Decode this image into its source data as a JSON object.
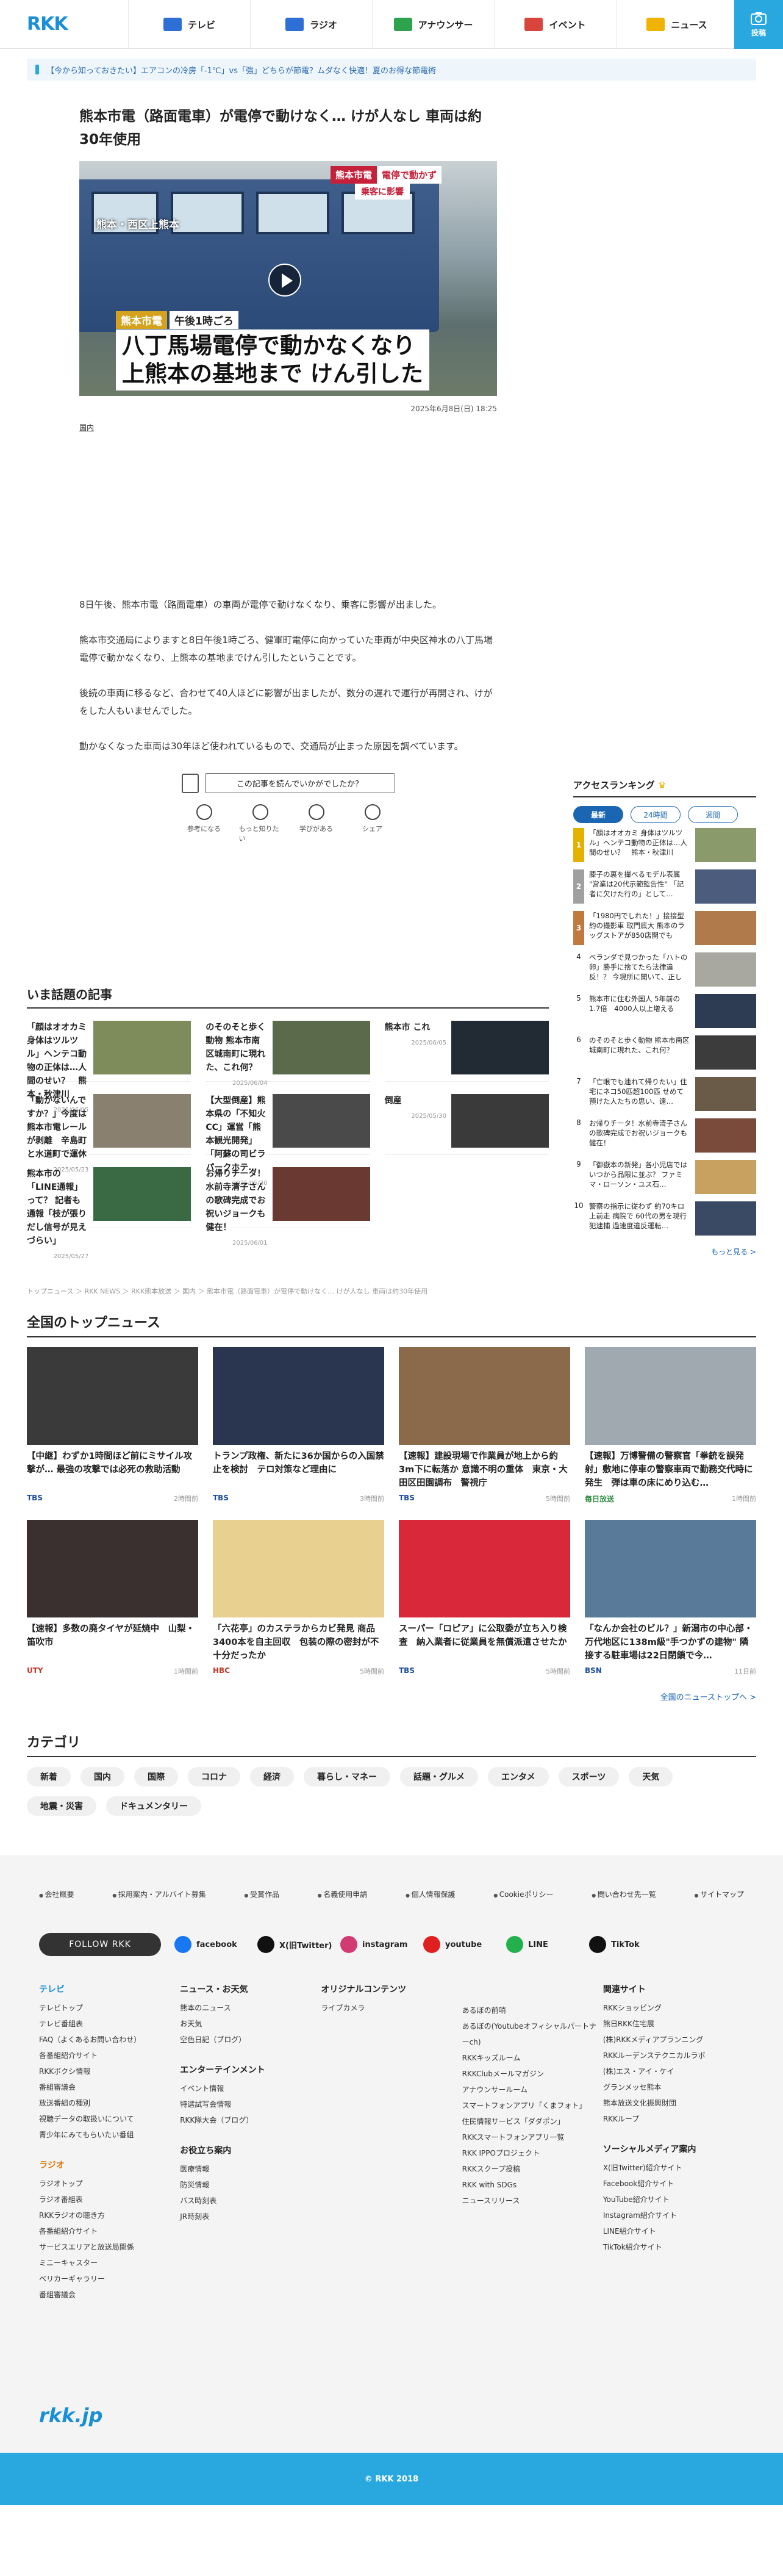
{
  "header": {
    "logo": "RKK",
    "nav": [
      {
        "label": "テレビ",
        "icon": "tv-icon",
        "color": "#2d6fd4"
      },
      {
        "label": "ラジオ",
        "icon": "radio-icon",
        "color": "#2d6fd4"
      },
      {
        "label": "アナウンサー",
        "icon": "microphone-icon",
        "color": "#2ea34d"
      },
      {
        "label": "イベント",
        "icon": "event-flag-icon",
        "color": "#d9453b"
      },
      {
        "label": "ニュース",
        "icon": "lightbulb-icon",
        "color": "#f0b400"
      }
    ],
    "submit_label": "投稿"
  },
  "notice": "【今から知っておきたい】エアコンの冷房「-1℃」vs「強」どちらが節電？ムダなく快適！夏のお得な節電術",
  "article": {
    "title": "熊本市電（路面電車）が電停で動けなく… けが人なし 車両は約30年使用",
    "hero": {
      "tag_station": "熊本市電",
      "tag_status": "電停で動かず",
      "tag_sub": "乗客に影響",
      "location": "熊本・西区上熊本",
      "time_station": "熊本市電",
      "time_text": "午後1時ごろ",
      "caption_line1": "八丁馬場電停で動かなくなり",
      "caption_line2": "上熊本の基地まで けん引した"
    },
    "date": "2025年6月8日(日) 18:25",
    "category": "国内",
    "paragraphs": [
      "8日午後、熊本市電（路面電車）の車両が電停で動けなくなり、乗客に影響が出ました。",
      "熊本市交通局によりますと8日午後1時ごろ、健軍町電停に向かっていた車両が中央区神水の八丁馬場電停で動かなくなり、上熊本の基地までけん引したということです。",
      "後続の車両に移るなど、合わせて40人ほどに影響が出ましたが、数分の遅れで運行が再開され、けがをした人もいませんでした。",
      "動かなくなった車両は30年ほど使われているもので、交通局が止まった原因を調べています。"
    ],
    "survey_question": "この記事を読んでいかがでしたか？",
    "reactions": [
      "参考になる",
      "もっと知りたい",
      "学びがある",
      "シェア"
    ]
  },
  "ranking": {
    "title": "アクセスランキング",
    "tabs": [
      "最新",
      "24時間",
      "週間"
    ],
    "items": [
      {
        "rank": "1",
        "text": "「顔はオオカミ 身体はツルツル」ヘンテコ動物の正体は…人間のせい？　熊本・秋津川",
        "img": "#8a9a6a"
      },
      {
        "rank": "2",
        "text": "膝子の裏を撮べるモデル表属 \"営業は20代示範監告性\" 「記者に欠けた行の」として…",
        "img": "#4b5c7c"
      },
      {
        "rank": "3",
        "text": "「1980円でしれた！」接接型約の撮影車 取門底大 熊本のラッグストアが850店開でも",
        "img": "#b07a4a"
      },
      {
        "rank": "4",
        "text": "ベランダで見つかった「ハトの卵」勝手に捨てたら法律違反！？ 今現所に聞いて、正しい…",
        "img": "#a8a8a0"
      },
      {
        "rank": "5",
        "text": "熊本市に住む外国人 5年前の1.7倍　4000人以上増える",
        "img": "#2d3c52"
      },
      {
        "rank": "6",
        "text": "のそのそと歩く動物 熊本市南区城南町に現れた、これ何？",
        "img": "#3c3c3c"
      },
      {
        "rank": "7",
        "text": "「亡眼でも連れて帰りたい」住宅にネコ50匹超100匹 せめて預けた人たちの思い、遠…",
        "img": "#6a5a48"
      },
      {
        "rank": "8",
        "text": "お帰りチータ！水前寺清子さんの歌碑完成でお祝いジョークも健在！",
        "img": "#7a4a3a"
      },
      {
        "rank": "9",
        "text": "「御嶽本の新発」各小児店ではいつから品限に並ぶ？ ファミマ・ローソン・ユス石…",
        "img": "#c8a060"
      },
      {
        "rank": "10",
        "text": "警察の指示に従わず 約70キロ上前走 病院で 60代の男を現行犯逮捕 過速度違反運転…",
        "img": "#3a4a64"
      }
    ],
    "more": "もっと見る >"
  },
  "hot": {
    "title": "いま話題の記事",
    "items": [
      {
        "text": "「顔はオオカミ 身体はツルツル」ヘンテコ動物の正体は…人間のせい？　熊本・秋津川",
        "date": "2025/06/05",
        "img": "#7d8c5a"
      },
      {
        "text": "のそのそと歩く動物 熊本市南区城南町に現れた、これ何？",
        "date": "2025/06/04",
        "img": "#5a6a4a"
      },
      {
        "text": "熊本市 これ",
        "date": "2025/06/05",
        "img": "#222a33"
      },
      {
        "text": "「動かないんですか？」今度は 熊本市電レールが剥離　辛島町と水道町で運休",
        "date": "2025/05/23",
        "img": "#8a8070"
      },
      {
        "text": "【大型倒産】熊本県の「不知火CC」運営「熊本観光開発」「阿蘇の司ビラパークホテ…",
        "date": "2025/05/30",
        "img": "#4a4a4a"
      },
      {
        "text": "倒産",
        "date": "2025/05/30",
        "img": "#3a3a3a"
      },
      {
        "text": "熊本市の「LINE通報」って？ 記者も通報「枝が張りだし信号が見えづらい」",
        "date": "2025/05/27",
        "img": "#3a6a44"
      },
      {
        "text": "お帰りチータ！水前寺清子さんの歌碑完成でお祝いジョークも健在！",
        "date": "2025/06/01",
        "img": "#6a3a32"
      },
      {
        "text": "",
        "date": "",
        "img": "#ffffff"
      }
    ]
  },
  "breadcrumb": "トップニュース ＞ RKK NEWS ＞ RKK熊本放送 ＞ 国内 ＞ 熊本市電（路面電車）が電停で動けなく… けが人なし 車両は約30年使用",
  "top_news": {
    "title": "全国のトップニュース",
    "items": [
      {
        "text": "【中継】わずか1時間ほど前にミサイル攻撃が… 最強の攻撃では必死の救助活動",
        "source": "TBS",
        "time": "2時間前",
        "img": "#3a3a3a",
        "src_color": "#1b4ea0"
      },
      {
        "text": "トランプ政権、新たに36か国からの入国禁止を検討　テロ対策など理由に",
        "source": "TBS",
        "time": "3時間前",
        "img": "#2a3550",
        "src_color": "#1b4ea0"
      },
      {
        "text": "【速報】建設現場で作業員が地上から約3m下に転落か 意識不明の重体　東京・大田区田園調布　警視庁",
        "source": "TBS",
        "time": "5時間前",
        "img": "#8a6a4a",
        "src_color": "#1b4ea0"
      },
      {
        "text": "【速報】万博警備の警察官「拳銃を誤発射」敷地に停車の警察車両で勤務交代時に発生　弾は車の床にめり込む…",
        "source": "毎日放送",
        "time": "1時間前",
        "img": "#a0a8b0",
        "src_color": "#2a8a3a"
      },
      {
        "text": "【速報】多数の廃タイヤが延焼中　山梨・笛吹市",
        "source": "UTY",
        "time": "1時間前",
        "img": "#3a3030",
        "src_color": "#c0392b"
      },
      {
        "text": "「六花亭」のカステラからカビ発見 商品3400本を自主回収　包装の際の密封が不十分だったか",
        "source": "HBC",
        "time": "5時間前",
        "img": "#e8d090",
        "src_color": "#c0392b"
      },
      {
        "text": "スーパー「ロピア」に公取委が立ち入り検査　納入業者に従業員を無償派遣させたか",
        "source": "TBS",
        "time": "5時間前",
        "img": "#d8283a",
        "src_color": "#1b4ea0"
      },
      {
        "text": "「なんか会社のビル？」新潟市の中心部・万代地区に138m級\"手つかずの建物\" 隣接する駐車場は22日閉鎖で今…",
        "source": "BSN",
        "time": "11日前",
        "img": "#5a7a9a",
        "src_color": "#1b4ea0"
      }
    ],
    "more": "全国のニューストップへ >"
  },
  "categories": {
    "title": "カテゴリ",
    "items": [
      "新着",
      "国内",
      "国際",
      "コロナ",
      "経済",
      "暮らし・マネー",
      "話題・グルメ",
      "エンタメ",
      "スポーツ",
      "天気",
      "地震・災害",
      "ドキュメンタリー"
    ]
  },
  "footer": {
    "links": [
      "会社概要",
      "採用案内・アルバイト募集",
      "受賞作品",
      "名義使用申請",
      "個人情報保護",
      "Cookieポリシー",
      "問い合わせ先一覧",
      "サイトマップ"
    ],
    "follow": "FOLLOW RKK",
    "social": [
      {
        "label": "facebook",
        "color": "#1877f2"
      },
      {
        "label": "X(旧Twitter)",
        "color": "#111111"
      },
      {
        "label": "instagram",
        "color": "#d23a74"
      },
      {
        "label": "youtube",
        "color": "#e02020"
      },
      {
        "label": "LINE",
        "color": "#22b14c"
      },
      {
        "label": "TikTok",
        "color": "#111111"
      }
    ],
    "cols": [
      {
        "groups": [
          {
            "title": "テレビ",
            "color": "blue",
            "items": [
              "テレビトップ",
              "テレビ番組表",
              "FAQ（よくあるお問い合わせ）",
              "各番組紹介サイト",
              "RKKボクシ情報",
              "番組審議会",
              "放送番組の種別",
              "視聴データの取扱いについて",
              "青少年にみてもらいたい番組"
            ]
          },
          {
            "title": "ラジオ",
            "color": "orange",
            "items": [
              "ラジオトップ",
              "ラジオ番組表",
              "RKKラジオの聴き方",
              "各番組紹介サイト",
              "サービスエリアと放送局関係",
              "ミニーキャスター",
              "ベリカーギャラリー",
              "番組審議会"
            ]
          }
        ]
      },
      {
        "groups": [
          {
            "title": "ニュース・お天気",
            "color": "dark",
            "items": [
              "熊本のニュース",
              "お天気",
              "空色日記（ブログ）"
            ]
          },
          {
            "title": "エンターテインメント",
            "color": "dark",
            "items": [
              "イベント情報",
              "特選試写会情報",
              "RKK隊大会（ブログ）"
            ]
          },
          {
            "title": "お役立ち案内",
            "color": "dark",
            "items": [
              "医療情報",
              "防災情報",
              "バス時刻表",
              "JR時刻表"
            ]
          }
        ]
      },
      {
        "groups": [
          {
            "title": "オリジナルコンテンツ",
            "color": "dark",
            "items": [
              "ライブカメラ"
            ]
          }
        ]
      },
      {
        "groups": [
          {
            "title": "",
            "color": "dark",
            "items": [
              "あるぼの前哨",
              "あるぼの(Youtubeオフィシャルパートナーch)",
              "RKKキッズルーム",
              "RKKClubメールマガジン",
              "アナウンサールーム",
              "スマートフォンアプリ「くまフォト」",
              "住民情報サービス「ダダポン」",
              "RKKスマートフォンアプリ一覧",
              "RKK IPPOプロジェクト",
              "RKKスクープ投稿",
              "RKK with SDGs",
              "ニュースリリース"
            ]
          }
        ]
      },
      {
        "groups": [
          {
            "title": "関連サイト",
            "color": "dark",
            "items": [
              "RKKショッピング",
              "熊日RKK住宅展",
              "(株)RKKメディアプランニング",
              "RKKルーデンステクニカルラボ",
              "(株)エス・アイ・ケイ",
              "グランメッセ熊本",
              "熊本放送文化振興財団",
              "RKKループ"
            ]
          },
          {
            "title": "ソーシャルメディア案内",
            "color": "dark",
            "items": [
              "X(旧Twitter)紹介サイト",
              "Facebook紹介サイト",
              "YouTube紹介サイト",
              "Instagram紹介サイト",
              "LINE紹介サイト",
              "TikTok紹介サイト"
            ]
          }
        ]
      }
    ],
    "logo": "rkk.jp",
    "copyright": "© RKK 2018"
  }
}
